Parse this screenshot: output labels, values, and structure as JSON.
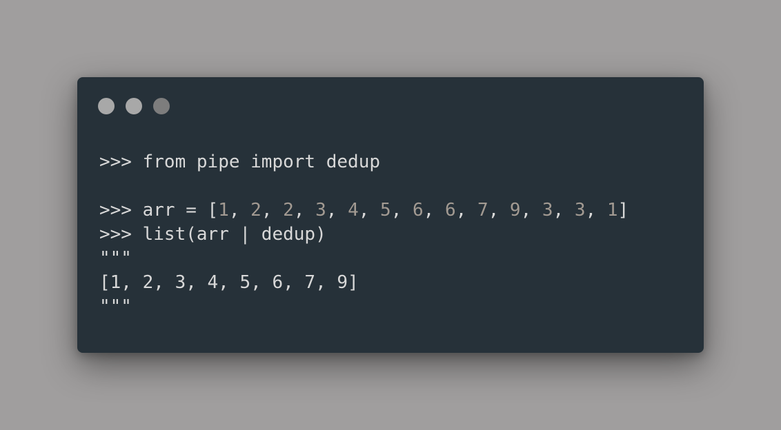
{
  "window": {
    "dots": [
      {
        "name": "window-dot-1",
        "color": "#a8a8a8"
      },
      {
        "name": "window-dot-2",
        "color": "#a8a8a8"
      },
      {
        "name": "window-dot-3",
        "color": "#7d7d7d"
      }
    ]
  },
  "code": {
    "prompt": ">>> ",
    "line1": "from pipe import dedup",
    "line2_prefix": "arr = [",
    "line2_numbers": [
      "1",
      "2",
      "2",
      "3",
      "4",
      "5",
      "6",
      "6",
      "7",
      "9",
      "3",
      "3",
      "1"
    ],
    "line2_suffix": "]",
    "line3": "list(arr | dedup)",
    "docstring": "\"\"\"",
    "output": "[1, 2, 3, 4, 5, 6, 7, 9]",
    "number_color": "#a29a92"
  }
}
